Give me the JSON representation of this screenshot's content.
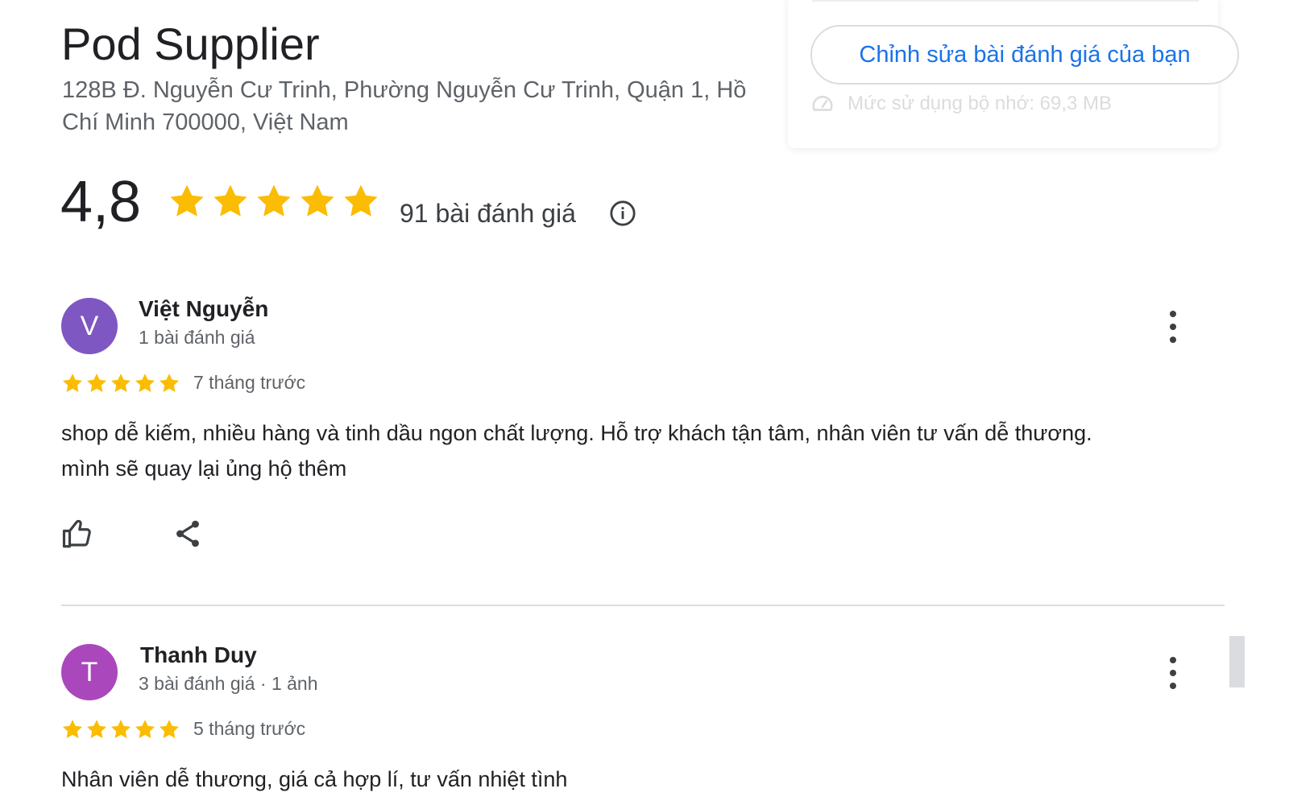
{
  "place": {
    "name": "Pod Supplier",
    "address": "128B Đ. Nguyễn Cư Trinh, Phường Nguyễn Cư Trinh, Quận 1, Hồ Chí Minh 700000, Việt Nam"
  },
  "overlay": {
    "edit_review_label": "Chỉnh sửa bài đánh giá của bạn",
    "memory_usage": "Mức sử dụng bộ nhớ: 69,3 MB",
    "memory_icon": "speedometer-icon"
  },
  "summary": {
    "rating": "4,8",
    "stars": 5,
    "review_count": "91 bài đánh giá",
    "info_icon": "info-icon"
  },
  "colors": {
    "star": "#fbbc04",
    "link": "#1a73e8",
    "avatar_v": "#7e57c2",
    "avatar_t": "#ab47bc",
    "divider": "#dadce0"
  },
  "reviews": [
    {
      "initial": "V",
      "name": "Việt Nguyễn",
      "meta": "1 bài đánh giá",
      "stars": 5,
      "date": "7 tháng trước",
      "text": "shop dễ kiếm, nhiều hàng và tinh dầu ngon chất lượng. Hỗ trợ khách tận tâm, nhân viên tư vấn dễ thương. mình sẽ quay lại ủng hộ thêm"
    },
    {
      "initial": "T",
      "name": "Thanh Duy",
      "meta": "3 bài đánh giá · 1 ảnh",
      "stars": 5,
      "date": "5 tháng trước",
      "text": "Nhân viên dễ thương, giá cả hợp lí, tư vấn nhiệt tình"
    }
  ]
}
